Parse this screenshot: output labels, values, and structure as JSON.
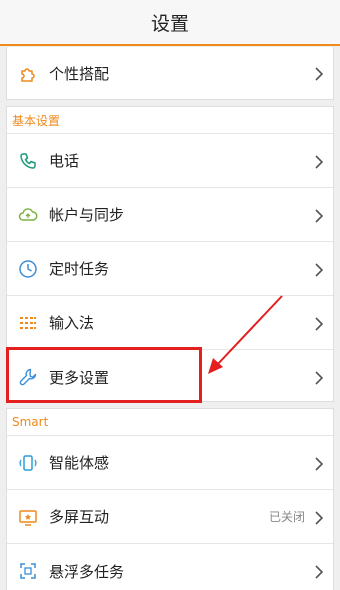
{
  "header": {
    "title": "设置"
  },
  "personal": {
    "items": [
      {
        "label": "个性搭配",
        "icon": "puzzle-icon"
      }
    ]
  },
  "basic": {
    "section_title": "基本设置",
    "items": [
      {
        "label": "电话",
        "icon": "phone-icon"
      },
      {
        "label": "帐户与同步",
        "icon": "cloud-sync-icon"
      },
      {
        "label": "定时任务",
        "icon": "clock-icon"
      },
      {
        "label": "输入法",
        "icon": "keyboard-icon"
      },
      {
        "label": "更多设置",
        "icon": "wrench-icon"
      }
    ]
  },
  "smart": {
    "section_title": "Smart",
    "items": [
      {
        "label": "智能体感",
        "icon": "motion-sense-icon"
      },
      {
        "label": "多屏互动",
        "icon": "multi-screen-icon",
        "status": "已关闭"
      },
      {
        "label": "悬浮多任务",
        "icon": "floating-window-icon"
      }
    ]
  },
  "colors": {
    "accent": "#ef8a1d",
    "annotation": "#e41f1f"
  }
}
